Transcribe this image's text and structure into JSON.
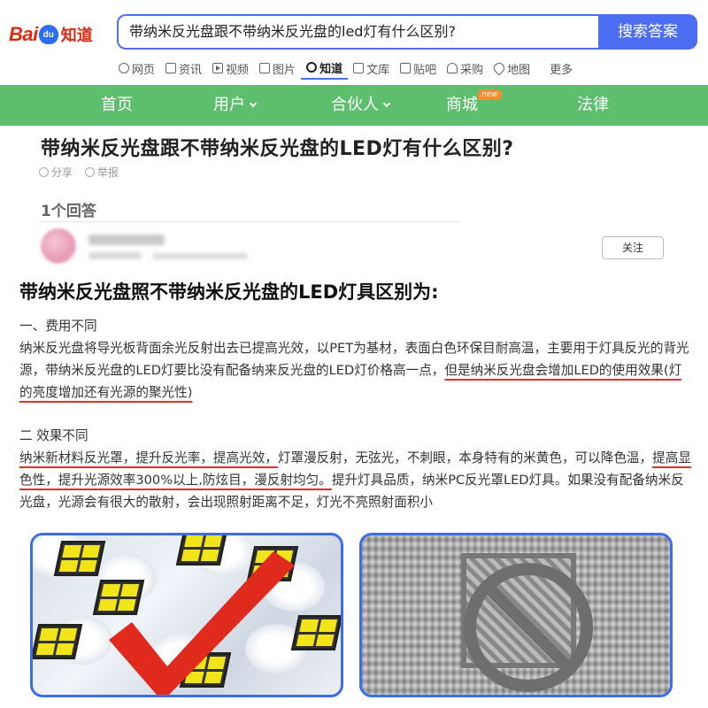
{
  "header": {
    "logo": {
      "bai": "Bai",
      "du": "du",
      "zhidao": "知道"
    },
    "search": {
      "query": "带纳米反光盘跟不带纳米反光盘的led灯有什么区别?",
      "button": "搜索答案"
    },
    "tabs": [
      {
        "label": "网页",
        "icon": "web-icon"
      },
      {
        "label": "资讯",
        "icon": "news-icon"
      },
      {
        "label": "视频",
        "icon": "video-icon"
      },
      {
        "label": "图片",
        "icon": "image-icon"
      },
      {
        "label": "知道",
        "icon": "zhidao-icon",
        "active": true
      },
      {
        "label": "文库",
        "icon": "wenku-icon"
      },
      {
        "label": "贴吧",
        "icon": "tieba-icon"
      },
      {
        "label": "采购",
        "icon": "cai-icon"
      },
      {
        "label": "地图",
        "icon": "map-icon"
      },
      {
        "label": "更多"
      }
    ]
  },
  "green_nav": {
    "home": "首页",
    "user": "用户",
    "partner": "合伙人",
    "mall": "商城",
    "new_badge": "new",
    "law": "法律"
  },
  "question": {
    "title": "带纳米反光盘跟不带纳米反光盘的LED灯有什么区别?",
    "share": "分享",
    "report": "举报",
    "answer_count": "1个回答"
  },
  "answer": {
    "follow": "关注",
    "heading": "带纳米反光盘照不带纳米反光盘的LED灯具区别为:",
    "s1_title": "一、费用不同",
    "s1_text": "纳米反光盘将导光板背面余光反射出去已提高光效，以PET为基材，表面白色环保目耐高温，主要用于灯具反光的背光源，带纳米反光盘的LED灯要比没有配备纳来反光盘的LED灯价格高一点，",
    "s1_ul": "但是纳米反光盘会增加LED的使用效果(灯的亮度增加还有光源的聚光性)",
    "s2_title": "二 效果不同",
    "s2_ul1": "纳米新材料反光罩，提升反光率，提高光效，",
    "s2_t1": "灯罩漫反射，无弦光，不刺眼，本身特有的米黄色，可以降色温，",
    "s2_ul2": "提高显色性，提升光源效率300%以上,防炫目，漫反射均匀。",
    "s2_t2": "提升灯具品质，纳米PC反光罩LED灯具。如果没有配备纳米反光盘，光源会有很大的散射，会出现照射距离不足，灯光不亮照射面积小"
  }
}
